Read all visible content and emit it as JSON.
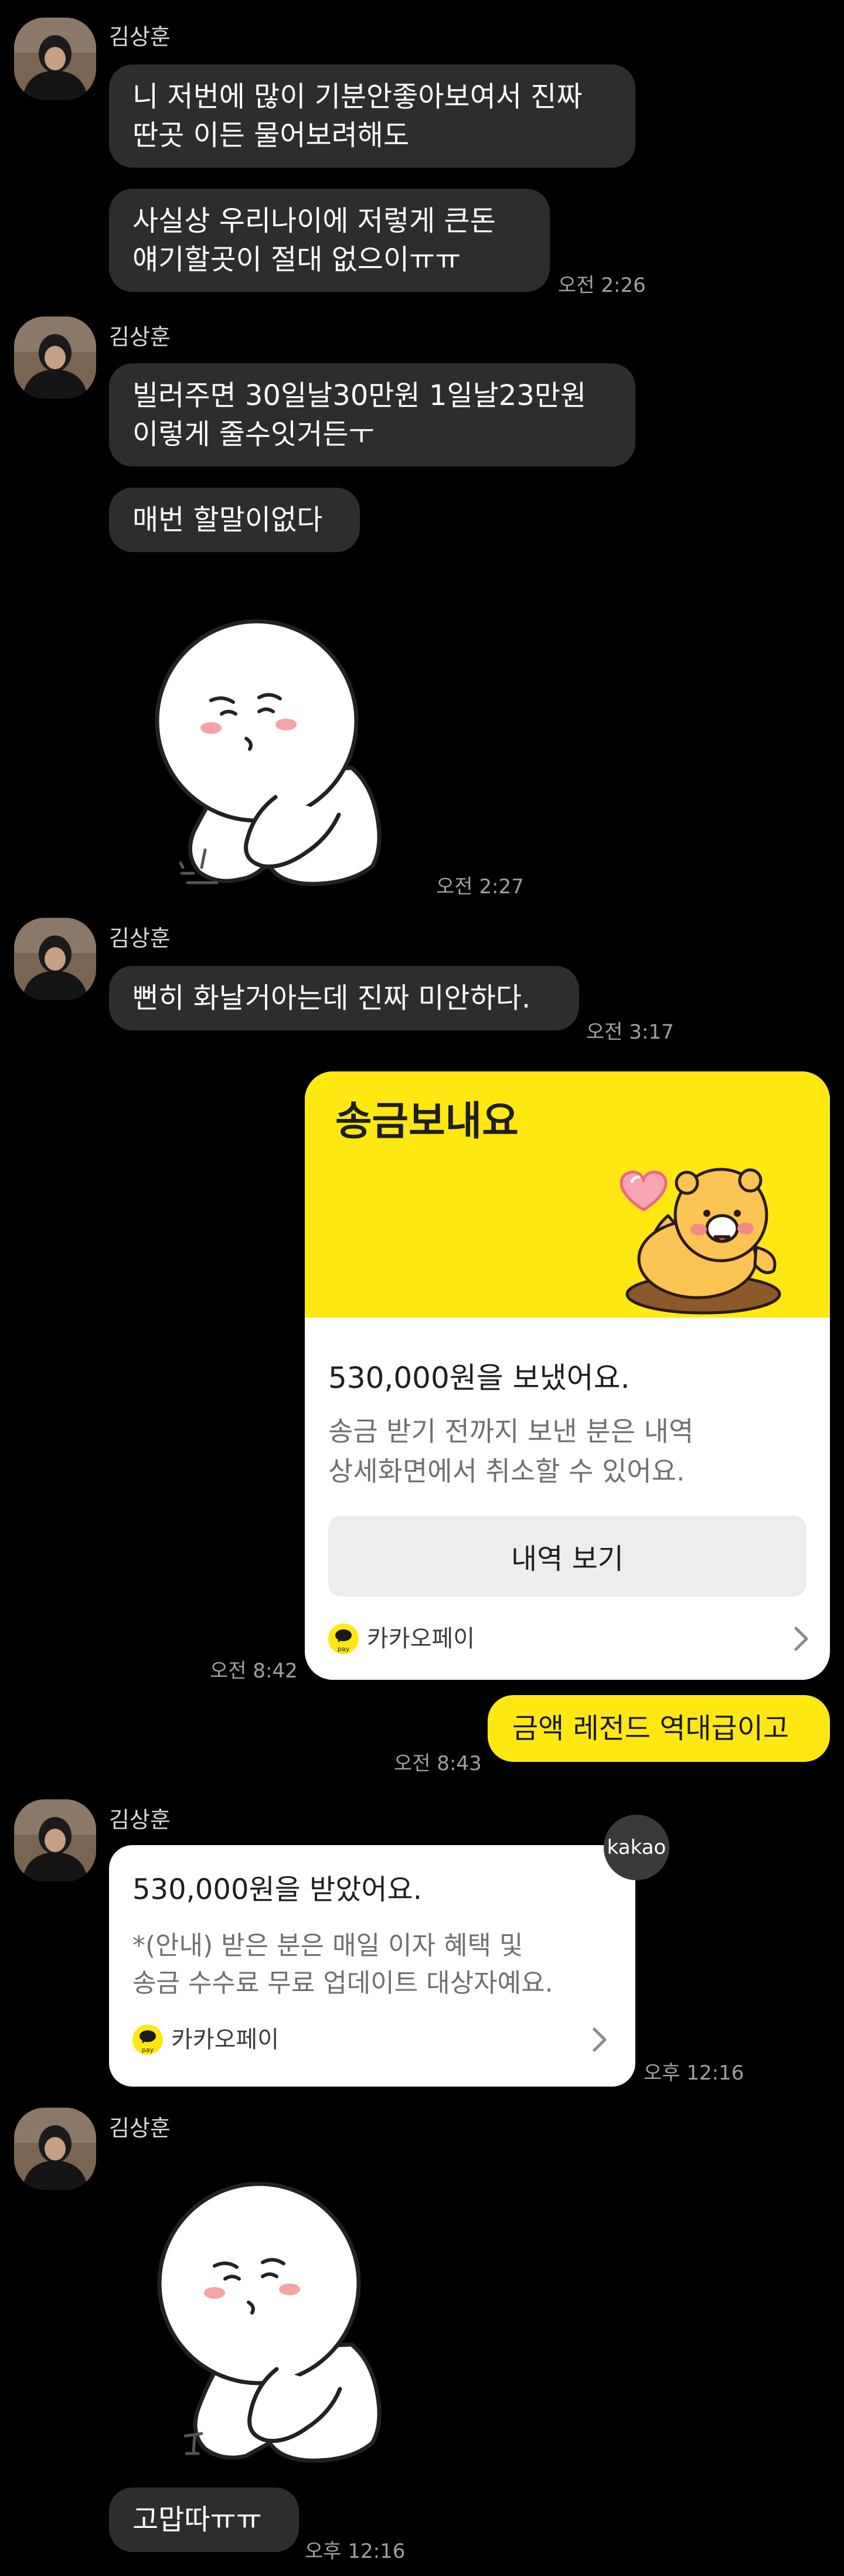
{
  "sender_name": "김상훈",
  "messages": {
    "m1": "니 저번에 많이 기분안좋아보여서 진짜\n딴곳 이든 물어보려해도",
    "m2": "사실상 우리나이에 저렇게 큰돈\n얘기할곳이 절대 없으이ㅠㅠ",
    "t2": "오전 2:26",
    "m3": "빌러주면 30일날30만원 1일날23만원\n이렇게 줄수잇거든ㅜ",
    "m4": "매번 할말이없다",
    "t_sticker1": "오전 2:27",
    "m5": "뻔히 화날거아는데 진짜 미안하다.",
    "t5": "오전 3:17",
    "t_card": "오전 8:42",
    "my_msg": "금액 레전드 역대급이고",
    "t_my": "오전 8:43",
    "t_received": "오후 12:16",
    "m_last": "고맙따ㅠㅠ",
    "t_last": "오후 12:16"
  },
  "transfer_card": {
    "title": "송금보내요",
    "amount": "530,000원을 보냈어요.",
    "description": "송금 받기 전까지 보낸 분은 내역\n상세화면에서 취소할 수 있어요.",
    "button": "내역 보기",
    "service": "카카오페이",
    "pay_badge": "pay"
  },
  "received_card": {
    "badge": "kakao",
    "amount": "530,000원을 받았어요.",
    "description": "*(안내) 받은 분은 매일 이자 혜택 및\n송금 수수료 무료 업데이트 대상자예요.",
    "service": "카카오페이",
    "pay_badge": "pay"
  },
  "colors": {
    "background": "#000000",
    "bubble": "#2d2d2d",
    "kakao_yellow": "#ffe812"
  }
}
